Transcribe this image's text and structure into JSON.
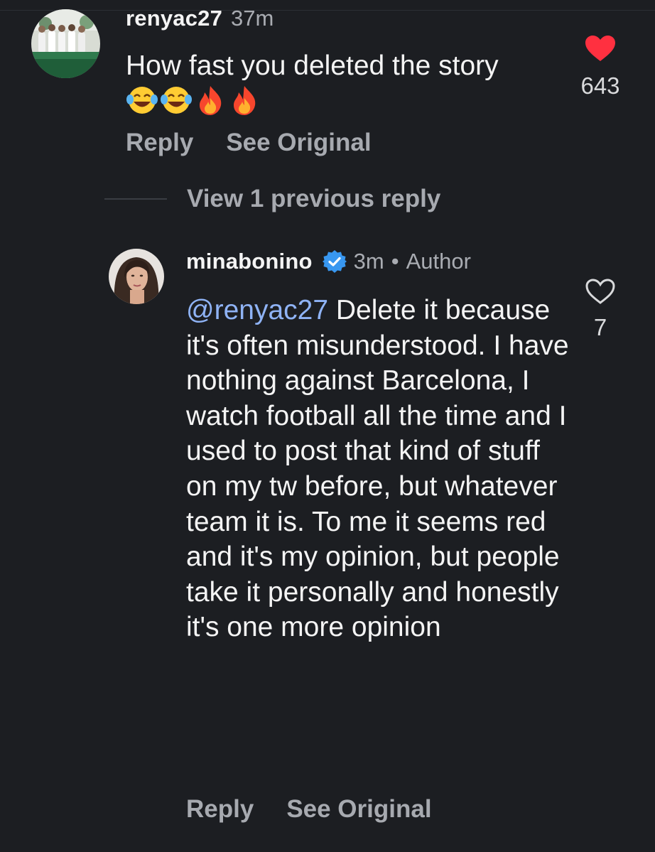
{
  "comments": [
    {
      "username": "renyac27",
      "time": "37m",
      "text": "How fast you deleted the story",
      "emoji": [
        "joy-emoji",
        "joy-emoji",
        "fire-emoji",
        "fire-emoji"
      ],
      "like_count": "643",
      "liked": true,
      "reply_label": "Reply",
      "see_original_label": "See Original"
    },
    {
      "username": "minabonino",
      "verified": true,
      "time": "3m",
      "separator": "•",
      "author_badge": "Author",
      "mention": "@renyac27",
      "text": " Delete it because it's often misunderstood. I have nothing against Barcelona, I watch football all the time and I used to post that kind of stuff on my tw before, but whatever team it is. To me it seems red and it's my opinion, but people take it personally and honestly it's one more opinion",
      "like_count": "7",
      "liked": false,
      "reply_label": "Reply",
      "see_original_label": "See Original"
    }
  ],
  "thread": {
    "view_replies_label": "View 1 previous reply"
  },
  "colors": {
    "background": "#1c1e22",
    "liked_heart": "#ff3040",
    "mention": "#8fb3f5",
    "verified_badge": "#3897f0"
  }
}
